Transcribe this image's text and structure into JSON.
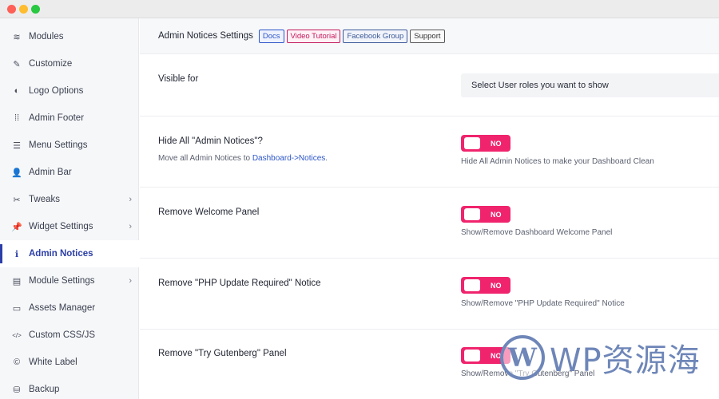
{
  "window": {
    "controls": [
      "close",
      "minimize",
      "zoom"
    ]
  },
  "sidebar": {
    "items": [
      {
        "label": "Modules",
        "icon": "layers-icon",
        "glyph": "≋",
        "chevron": false,
        "active": false
      },
      {
        "label": "Customize",
        "icon": "paint-icon",
        "glyph": "✎",
        "chevron": false,
        "active": false
      },
      {
        "label": "Logo Options",
        "icon": "contrast-icon",
        "glyph": "◐",
        "chevron": false,
        "active": false
      },
      {
        "label": "Admin Footer",
        "icon": "dots-grid-icon",
        "glyph": "⁞⁞",
        "chevron": false,
        "active": false
      },
      {
        "label": "Menu Settings",
        "icon": "menu-icon",
        "glyph": "☰",
        "chevron": false,
        "active": false
      },
      {
        "label": "Admin Bar",
        "icon": "user-gear-icon",
        "glyph": "👤",
        "chevron": false,
        "active": false
      },
      {
        "label": "Tweaks",
        "icon": "tools-icon",
        "glyph": "✂",
        "chevron": true,
        "active": false
      },
      {
        "label": "Widget Settings",
        "icon": "pin-icon",
        "glyph": "📌",
        "chevron": true,
        "active": false
      },
      {
        "label": "Admin Notices",
        "icon": "info-icon",
        "glyph": "ℹ",
        "chevron": false,
        "active": true
      },
      {
        "label": "Module Settings",
        "icon": "archive-icon",
        "glyph": "▤",
        "chevron": true,
        "active": false
      },
      {
        "label": "Assets Manager",
        "icon": "folder-icon",
        "glyph": "▭",
        "chevron": false,
        "active": false
      },
      {
        "label": "Custom CSS/JS",
        "icon": "code-icon",
        "glyph": "</>",
        "chevron": false,
        "active": false
      },
      {
        "label": "White Label",
        "icon": "copyright-icon",
        "glyph": "©",
        "chevron": false,
        "active": false
      },
      {
        "label": "Backup",
        "icon": "database-icon",
        "glyph": "⛁",
        "chevron": false,
        "active": false
      }
    ],
    "chevron_glyph": "›"
  },
  "header": {
    "title": "Admin Notices Settings",
    "badges": {
      "docs": "Docs",
      "video": "Video Tutorial",
      "facebook": "Facebook Group",
      "support": "Support"
    }
  },
  "settings": {
    "visible_for": {
      "label": "Visible for",
      "placeholder": "Select User roles you want to show"
    },
    "hide_all": {
      "label": "Hide All \"Admin Notices\"?",
      "desc_prefix": "Move all Admin Notices to ",
      "desc_link": "Dashboard->Notices",
      "desc_suffix": ".",
      "toggle": "NO",
      "help": "Hide All Admin Notices to make your Dashboard Clean"
    },
    "welcome_panel": {
      "label": "Remove Welcome Panel",
      "toggle": "NO",
      "help": "Show/Remove Dashboard Welcome Panel"
    },
    "php_update": {
      "label": "Remove \"PHP Update Required\" Notice",
      "toggle": "NO",
      "help": "Show/Remove \"PHP Update Required\" Notice"
    },
    "gutenberg": {
      "label": "Remove \"Try Gutenberg\" Panel",
      "toggle": "NO",
      "help": "Show/Remove \"Try Gutenberg\" Panel"
    }
  },
  "watermark": {
    "logo_letter": "W",
    "text": "WP资源海"
  },
  "colors": {
    "accent": "#2c3ea8",
    "toggle": "#f0246d",
    "link": "#2c55c9"
  }
}
